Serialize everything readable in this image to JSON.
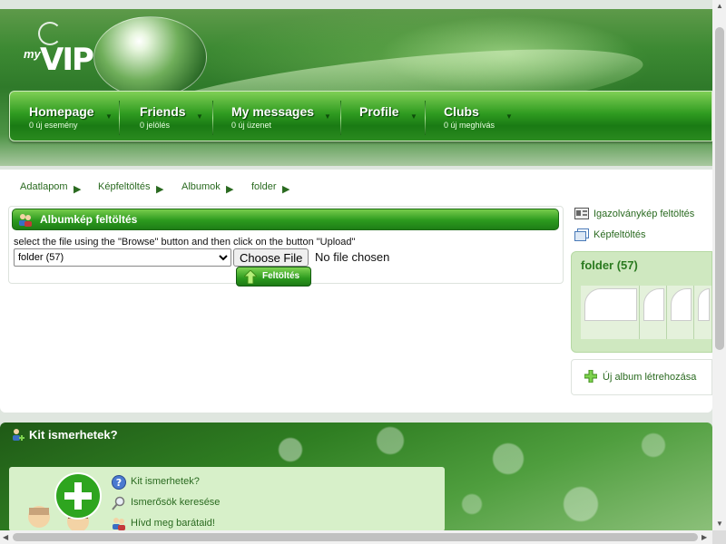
{
  "nav": {
    "items": [
      {
        "label": "Homepage",
        "sub": "0 új esemény"
      },
      {
        "label": "Friends",
        "sub": "0 jelölés"
      },
      {
        "label": "My messages",
        "sub": "0 új üzenet"
      },
      {
        "label": "Profile",
        "sub": ""
      },
      {
        "label": "Clubs",
        "sub": "0 új meghívás"
      }
    ]
  },
  "logo": {
    "my": "my",
    "vip": "VIP"
  },
  "breadcrumb": [
    "Adatlapom",
    "Képfeltöltés",
    "Albumok",
    "folder"
  ],
  "upload": {
    "title": "Albumkép feltöltés",
    "instruction": "select the file using the \"Browse\" button and then click on the button \"Upload\"",
    "folder_selected": "folder (57)",
    "choose_label": "Choose File",
    "no_file": "No file chosen",
    "submit_label": "Feltöltés"
  },
  "sidebar": {
    "id_upload": "Igazolványkép feltöltés",
    "photo_upload": "Képfeltöltés",
    "folder_title": "folder (57)",
    "new_album": "Új album létrehozása"
  },
  "lower": {
    "title": "Kit ismerhetek?",
    "links": [
      "Kit ismerhetek?",
      "Ismerősök keresése",
      "Hívd meg barátaid!"
    ]
  },
  "colors": {
    "accent_green": "#2c9a1e",
    "link_green": "#2a6a20",
    "panel_green": "#cfe8c0"
  }
}
